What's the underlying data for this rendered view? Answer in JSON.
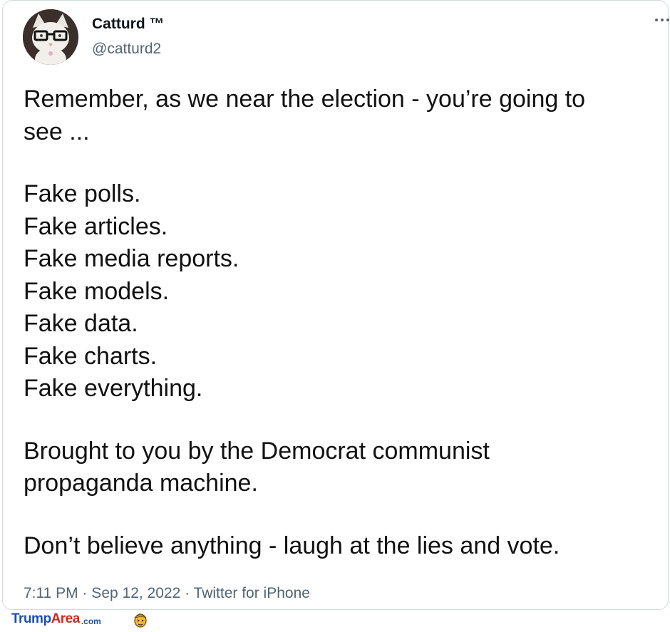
{
  "tweet": {
    "display_name": "Catturd ™",
    "handle": "@catturd2",
    "avatar_icon": "cat-with-glasses-avatar",
    "more_icon": "more-options-icon",
    "lines": [
      "Remember, as we near the election - you’re going to",
      "see ...",
      "Fake polls.",
      "Fake articles.",
      "Fake media reports.",
      "Fake models.",
      "Fake data.",
      "Fake charts.",
      "Fake everything.",
      "Brought to you by the Democrat communist",
      "propaganda machine.",
      "Don’t believe anything - laugh at the lies and vote."
    ],
    "meta": "7:11 PM · Sep 12, 2022 · Twitter for iPhone"
  },
  "watermark": {
    "part1": "Trump",
    "part2": "Area",
    "part3": ".com",
    "icon": "trump-face-icon"
  },
  "colors": {
    "text": "#0f1419",
    "secondary": "#536471",
    "border": "#cfd9de",
    "watermark_blue": "#1a4fb0",
    "watermark_red": "#d8261f"
  }
}
